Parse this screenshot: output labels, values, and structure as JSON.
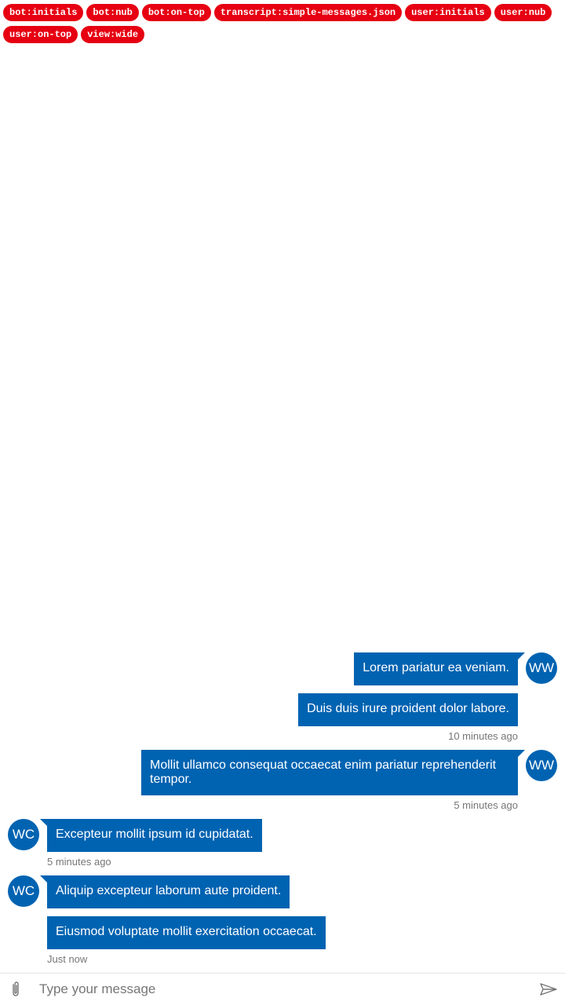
{
  "tags": [
    "bot:initials",
    "bot:nub",
    "bot:on-top",
    "transcript:simple-messages.json",
    "user:initials",
    "user:nub",
    "user:on-top",
    "view:wide"
  ],
  "user": {
    "initials": "WW"
  },
  "bot": {
    "initials": "WC"
  },
  "messages": {
    "m1": "Lorem pariatur ea veniam.",
    "m2": "Duis duis irure proident dolor labore.",
    "m2_time": "10 minutes ago",
    "m3": "Mollit ullamco consequat occaecat enim pariatur reprehenderit tempor.",
    "m3_time": "5 minutes ago",
    "m4": "Excepteur mollit ipsum id cupidatat.",
    "m4_time": "5 minutes ago",
    "m5": "Aliquip excepteur laborum aute proident.",
    "m6": "Eiusmod voluptate mollit exercitation occaecat.",
    "m6_time": "Just now"
  },
  "sendbox": {
    "placeholder": "Type your message",
    "attach_icon": "paperclip-icon",
    "send_icon": "send-icon"
  },
  "colors": {
    "accent": "#0063b1",
    "tag": "#e60012",
    "timestamp": "#767676"
  }
}
